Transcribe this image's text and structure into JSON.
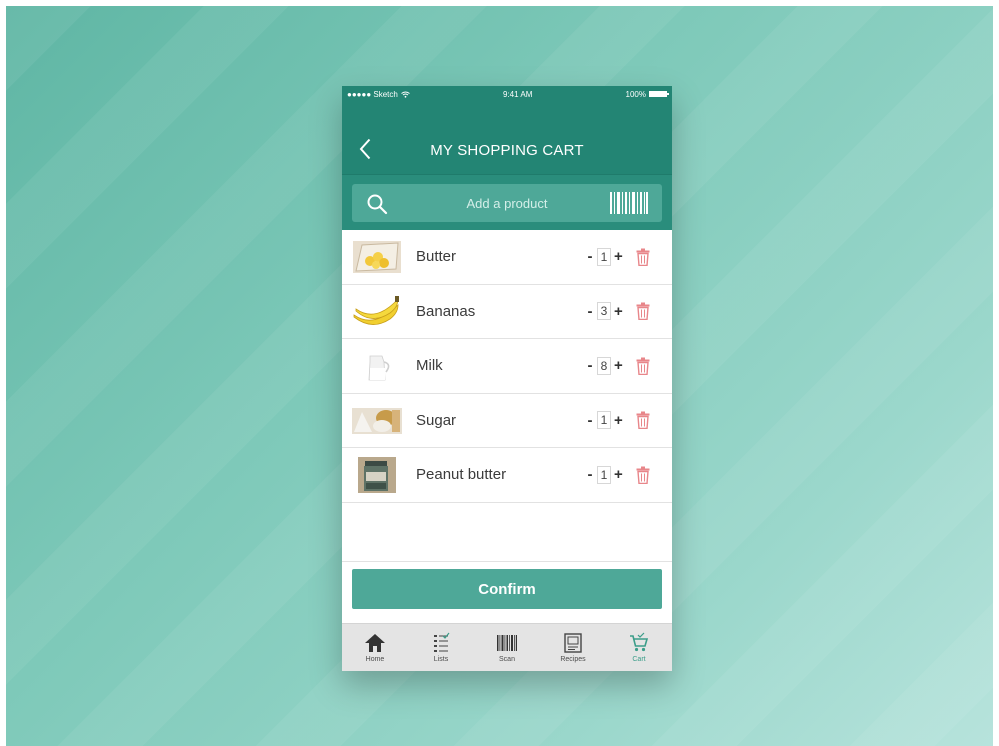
{
  "status_bar": {
    "carrier": "●●●●● Sketch",
    "time": "9:41 AM",
    "battery": "100%"
  },
  "header": {
    "title": "MY SHOPPING CART"
  },
  "search": {
    "placeholder": "Add a product"
  },
  "items": [
    {
      "name": "Butter",
      "quantity": "1",
      "image": "butter-image"
    },
    {
      "name": "Bananas",
      "quantity": "3",
      "image": "bananas-image"
    },
    {
      "name": "Milk",
      "quantity": "8",
      "image": "milk-image"
    },
    {
      "name": "Sugar",
      "quantity": "1",
      "image": "sugar-image"
    },
    {
      "name": "Peanut butter",
      "quantity": "1",
      "image": "peanut-butter-image"
    }
  ],
  "qty_controls": {
    "decrement": "-",
    "increment": "+"
  },
  "confirm": {
    "label": "Confirm"
  },
  "tabs": [
    {
      "label": "Home",
      "icon": "home-icon",
      "active": false
    },
    {
      "label": "Lists",
      "icon": "list-icon",
      "active": false
    },
    {
      "label": "Scan",
      "icon": "barcode-icon",
      "active": false
    },
    {
      "label": "Recipes",
      "icon": "recipe-book-icon",
      "active": false
    },
    {
      "label": "Cart",
      "icon": "cart-icon",
      "active": true
    }
  ],
  "colors": {
    "primary": "#238574",
    "accent": "#4ea898",
    "delete": "#e8868a",
    "active_tab": "#3b9d89"
  }
}
